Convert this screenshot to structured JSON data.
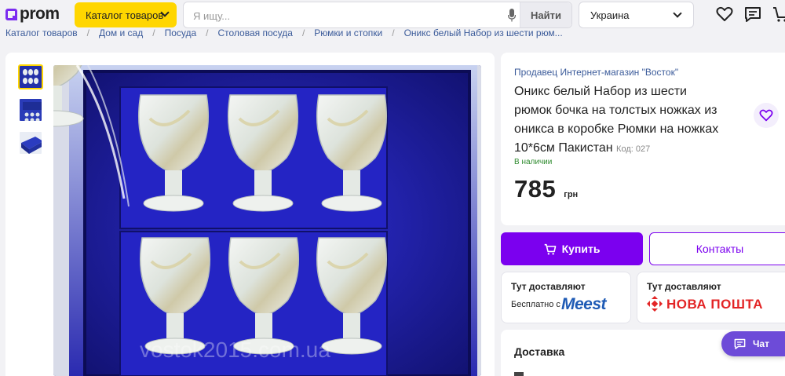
{
  "header": {
    "logo_text": "prom",
    "catalog_label": "Каталог товаров",
    "search_placeholder": "Я ищу...",
    "search_button": "Найти",
    "region": "Украина",
    "icons": [
      "heart-icon",
      "chat-icon",
      "cart-icon"
    ]
  },
  "breadcrumb": {
    "items": [
      "Каталог товаров",
      "Дом и сад",
      "Посуда",
      "Столовая посуда",
      "Рюмки и стопки",
      "Оникс белый Набор из шести рюм..."
    ]
  },
  "gallery": {
    "thumbnails": [
      "glasses-set-thumb",
      "blue-box-open-thumb",
      "blue-box-closed-thumb"
    ],
    "active_thumb": 0,
    "watermark": "vostok2015.com.ua"
  },
  "product": {
    "seller": "Продавец Интернет-магазин \"Восток\"",
    "title": "Оникс белый Набор из шести рюмок бочка на толстых ножках из оникса в коробке Рюмки на ножках 10*6см Пакистан",
    "code": "Код: 027",
    "stock": "В наличии",
    "price": "785",
    "currency": "грн"
  },
  "actions": {
    "buy": "Купить",
    "contacts": "Контакты"
  },
  "delivery_options": [
    {
      "title": "Тут доставляют",
      "subtitle": "Бесплатно с",
      "brand": "Meest"
    },
    {
      "title": "Тут доставляют",
      "brand": "НОВА ПОШТА"
    }
  ],
  "delivery_section": {
    "title": "Доставка"
  },
  "chat": {
    "label": "Чат"
  },
  "colors": {
    "accent": "#7b00ef",
    "catalog_yellow": "#ffd600",
    "link": "#3b5b9a",
    "in_stock": "#2e8a2e",
    "meest": "#1f5bb5",
    "nova_poshta": "#e32526"
  }
}
